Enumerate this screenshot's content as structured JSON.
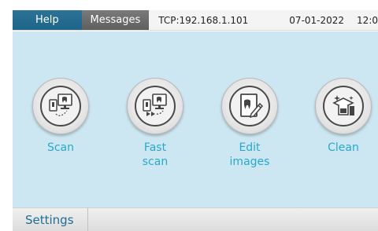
{
  "tabs": {
    "help": "Help",
    "messages": "Messages"
  },
  "status": {
    "connection": "TCP:192.168.1.101",
    "date": "07-01-2022",
    "time": "12:0"
  },
  "actions": [
    {
      "line1": "Scan",
      "line2": "",
      "icon": "scan-icon"
    },
    {
      "line1": "Fast",
      "line2": "scan",
      "icon": "fast-scan-icon"
    },
    {
      "line1": "Edit",
      "line2": "images",
      "icon": "edit-images-icon"
    },
    {
      "line1": "Clean",
      "line2": "",
      "icon": "clean-icon"
    }
  ],
  "bottom": {
    "settings": "Settings"
  },
  "colors": {
    "help_tab": "#1f6489",
    "messages_tab": "#666666",
    "panel": "#cce7f2",
    "label": "#2aa8c8",
    "settings": "#1e6e95"
  }
}
